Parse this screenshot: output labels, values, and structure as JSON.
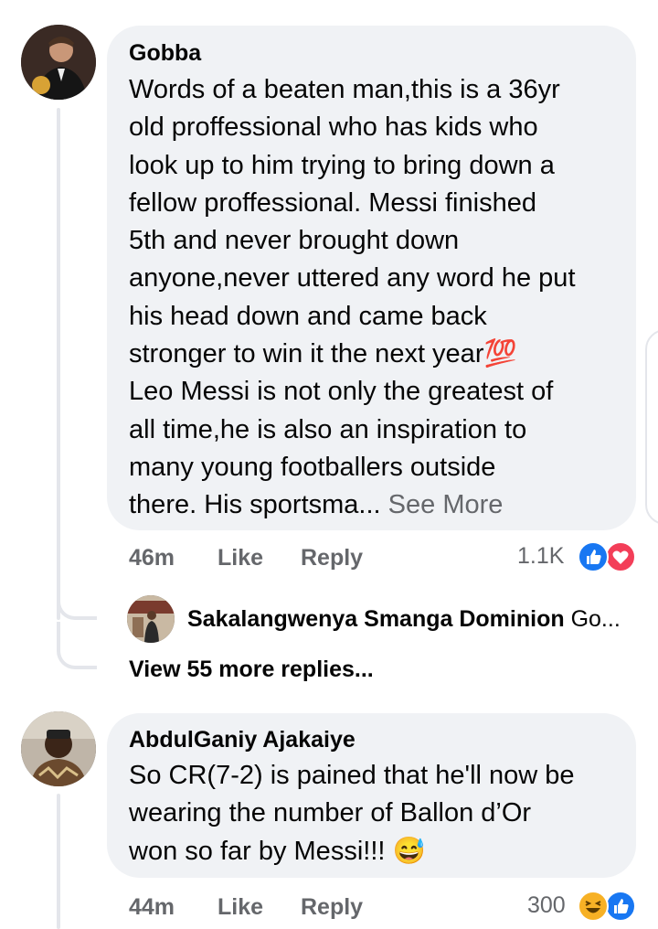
{
  "comment1": {
    "author": "Gobba",
    "text_lines": [
      "Words of a beaten man,this is a 36yr",
      "old proffessional who has kids who",
      "look up to him trying to bring down a",
      "fellow proffessional. Messi finished",
      "5th and never brought down",
      "anyone,never uttered any word he put",
      "his head down and came back",
      "stronger to win it the next year💯",
      "Leo Messi is not only the greatest of",
      "all time,he is also an inspiration to",
      "many young footballers outside",
      "there. His sportsma..."
    ],
    "see_more": "See More",
    "time": "46m",
    "like_label": "Like",
    "reply_label": "Reply",
    "reaction_count": "1.1K",
    "reactions": [
      "like-icon",
      "love-icon"
    ],
    "colors": {
      "like": "#1877f2",
      "love": "#f33e58"
    }
  },
  "reply1": {
    "author": "Sakalangwenya Smanga Dominion",
    "preview": "Go..."
  },
  "view_more": "View 55 more replies...",
  "comment2": {
    "author": "AbdulGaniy Ajakaiye",
    "text_lines": [
      "So CR(7-2) is pained that he'll now be",
      "wearing the number of Ballon d’Or",
      "won so far by Messi!!! 😅"
    ],
    "time": "44m",
    "like_label": "Like",
    "reply_label": "Reply",
    "reaction_count": "300",
    "reactions": [
      "haha-icon",
      "like-icon"
    ],
    "colors": {
      "haha": "#f7b125"
    }
  }
}
